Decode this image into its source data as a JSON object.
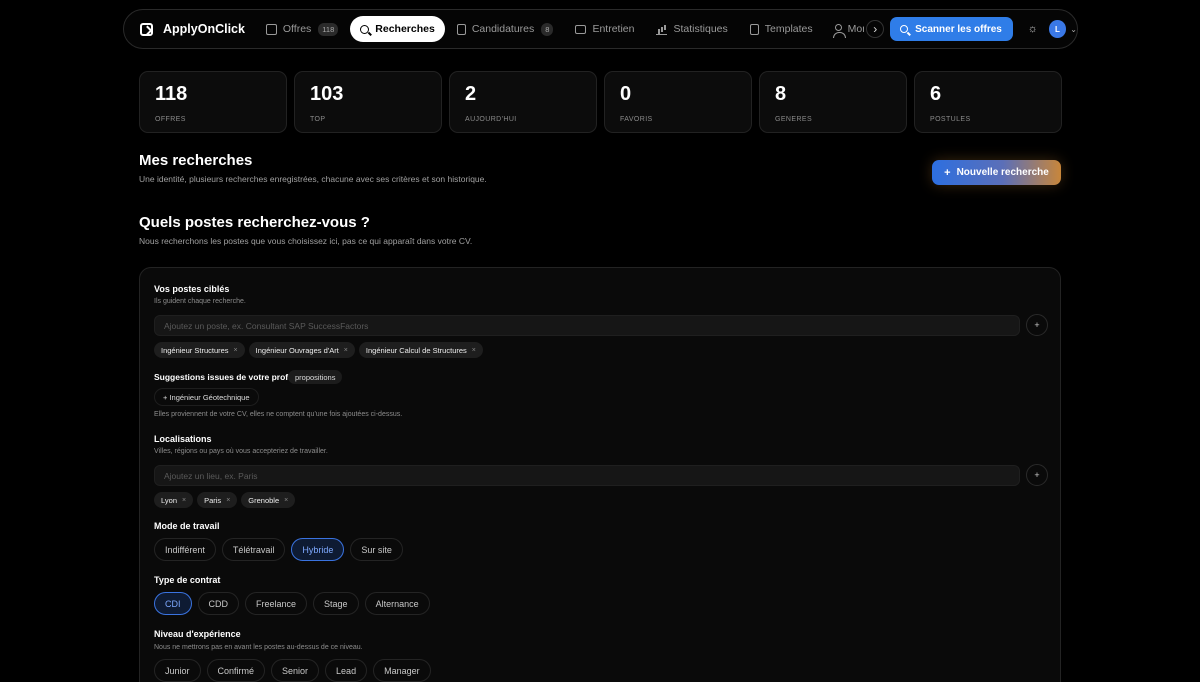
{
  "brand": {
    "name": "ApplyOnClick"
  },
  "nav": {
    "items": [
      {
        "label": "Offres",
        "badge": "118",
        "icon": "inbox-icon",
        "active": false
      },
      {
        "label": "Recherches",
        "badge": "",
        "icon": "search-icon",
        "active": true
      },
      {
        "label": "Candidatures",
        "badge": "8",
        "icon": "clipboard-icon",
        "active": false
      },
      {
        "label": "Entretien",
        "badge": "",
        "icon": "chat-icon",
        "active": false
      },
      {
        "label": "Statistiques",
        "badge": "",
        "icon": "bar-chart-icon",
        "active": false
      },
      {
        "label": "Templates",
        "badge": "",
        "icon": "file-icon",
        "active": false
      },
      {
        "label": "Mon Profil",
        "badge": "",
        "icon": "user-icon",
        "active": false
      }
    ],
    "scan_label": "Scanner les offres",
    "avatar_initial": "L"
  },
  "stats": [
    {
      "value": "118",
      "label": "OFFRES"
    },
    {
      "value": "103",
      "label": "TOP"
    },
    {
      "value": "2",
      "label": "AUJOURD'HUI"
    },
    {
      "value": "0",
      "label": "FAVORIS"
    },
    {
      "value": "8",
      "label": "GENERES"
    },
    {
      "value": "6",
      "label": "POSTULES"
    }
  ],
  "searches": {
    "title": "Mes recherches",
    "subtitle": "Une identité, plusieurs recherches enregistrées, chacune avec ses critères et son historique.",
    "new_label": "Nouvelle recherche"
  },
  "postes": {
    "title": "Quels postes recherchez-vous ?",
    "subtitle": "Nous recherchons les postes que vous choisissez ici, pas ce qui apparaît dans votre CV."
  },
  "form": {
    "targets": {
      "label": "Vos postes ciblés",
      "hint": "Ils guident chaque recherche.",
      "placeholder": "Ajoutez un poste, ex. Consultant SAP SuccessFactors",
      "tags": [
        "Ingénieur Structures",
        "Ingénieur Ouvrages d'Art",
        "Ingénieur Calcul de Structures"
      ]
    },
    "suggestions": {
      "label": "Suggestions issues de votre profil",
      "pill": "propositions",
      "chip": "+ Ingénieur Géotechnique",
      "note": "Elles proviennent de votre CV, elles ne comptent qu'une fois ajoutées ci-dessus."
    },
    "locations": {
      "label": "Localisations",
      "hint": "Villes, régions ou pays où vous accepteriez de travailler.",
      "placeholder": "Ajoutez un lieu, ex. Paris",
      "tags": [
        "Lyon",
        "Paris",
        "Grenoble"
      ]
    },
    "work_mode": {
      "label": "Mode de travail",
      "options": [
        "Indifférent",
        "Télétravail",
        "Hybride",
        "Sur site"
      ],
      "selected": "Hybride"
    },
    "contract": {
      "label": "Type de contrat",
      "options": [
        "CDI",
        "CDD",
        "Freelance",
        "Stage",
        "Alternance"
      ],
      "selected": "CDI"
    },
    "experience": {
      "label": "Niveau d'expérience",
      "hint": "Nous ne mettrons pas en avant les postes au-dessus de ce niveau.",
      "options": [
        "Junior",
        "Confirmé",
        "Senior",
        "Lead",
        "Manager"
      ],
      "selected": ""
    }
  }
}
